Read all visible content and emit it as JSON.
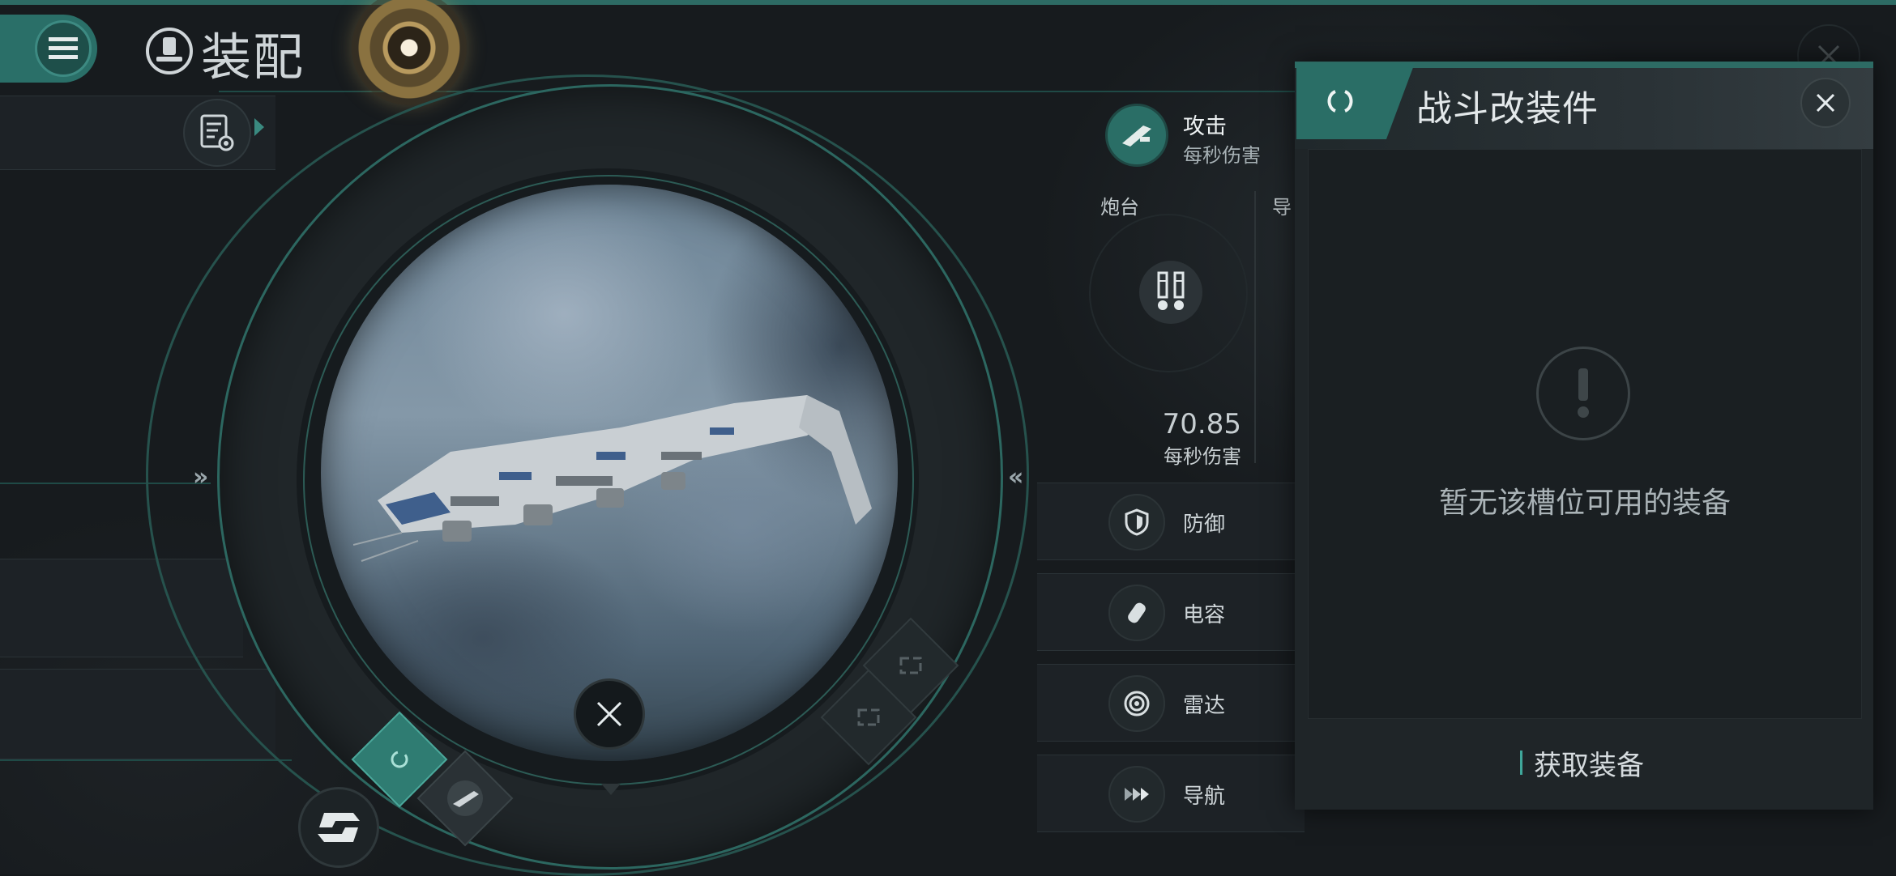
{
  "header": {
    "title": "装配",
    "menu_icon": "hamburger-icon",
    "title_icon": "helmet-icon"
  },
  "ship_view": {
    "left_chevron": "»",
    "right_chevron": "«"
  },
  "stats": {
    "attack": {
      "title": "攻击",
      "subtitle": "每秒伤害"
    },
    "turret": {
      "label": "炮台",
      "value": "70.85",
      "unit": "每秒伤害"
    },
    "missile": {
      "label": "导"
    },
    "rows": [
      {
        "label": "防御",
        "icon": "shield-icon"
      },
      {
        "label": "电容",
        "icon": "capacitor-icon"
      },
      {
        "label": "雷达",
        "icon": "radar-icon"
      },
      {
        "label": "导航",
        "icon": "navigation-icon"
      }
    ]
  },
  "popup": {
    "title": "战斗改装件",
    "empty_message": "暂无该槽位可用的装备",
    "acquire_label": "获取装备"
  },
  "colors": {
    "accent": "#2a6e66",
    "accent_light": "#3fa79a",
    "gold": "#b89a5e",
    "background": "#171b1e"
  }
}
